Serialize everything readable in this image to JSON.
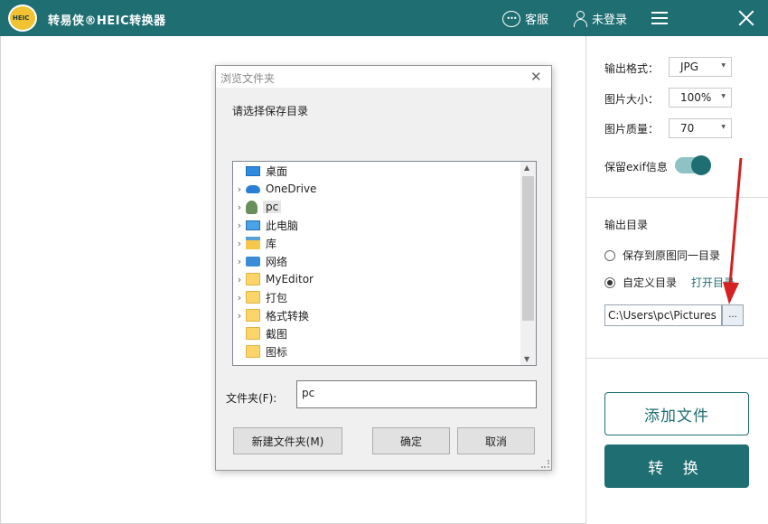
{
  "app": {
    "title": "转易侠®HEIC转换器",
    "logo_text": "HEIC",
    "service_label": "客服",
    "login_label": "未登录"
  },
  "settings": {
    "output_format_label": "输出格式：",
    "output_format_value": "JPG",
    "image_size_label": "图片大小：",
    "image_size_value": "100%",
    "image_quality_label": "图片质量：",
    "image_quality_value": "70",
    "keep_exif_label": "保留exif信息",
    "keep_exif_on": true
  },
  "output_dir": {
    "label": "输出目录",
    "option_same_label": "保存到原图同一目录",
    "option_custom_label": "自定义目录",
    "open_dir_label": "打开目录",
    "path_value": "C:\\Users\\pc\\Pictures",
    "browse_label": "..."
  },
  "actions": {
    "add_file_label": "添加文件",
    "convert_label": "转 换"
  },
  "dialog": {
    "title": "浏览文件夹",
    "prompt": "请选择保存目录",
    "tree_items": [
      {
        "label": "桌面",
        "icon": "desktop-icon",
        "expandable": false
      },
      {
        "label": "OneDrive",
        "icon": "cloud-icon",
        "expandable": true
      },
      {
        "label": "pc",
        "icon": "person-icon",
        "expandable": true,
        "selected": true
      },
      {
        "label": "此电脑",
        "icon": "monitor-icon",
        "expandable": true
      },
      {
        "label": "库",
        "icon": "library-icon",
        "expandable": true
      },
      {
        "label": "网络",
        "icon": "network-icon",
        "expandable": true
      },
      {
        "label": "MyEditor",
        "icon": "folder-icon",
        "expandable": true
      },
      {
        "label": "打包",
        "icon": "folder-icon",
        "expandable": true
      },
      {
        "label": "格式转换",
        "icon": "folder-icon",
        "expandable": true
      },
      {
        "label": "截图",
        "icon": "folder-icon",
        "expandable": false
      },
      {
        "label": "图标",
        "icon": "folder-icon",
        "expandable": false
      }
    ],
    "folder_label": "文件夹(F):",
    "folder_value": "pc",
    "new_folder_label": "新建文件夹(M)",
    "ok_label": "确定",
    "cancel_label": "取消"
  },
  "colors": {
    "brand": "#1f6e72",
    "annotation_arrow": "#d42020"
  }
}
